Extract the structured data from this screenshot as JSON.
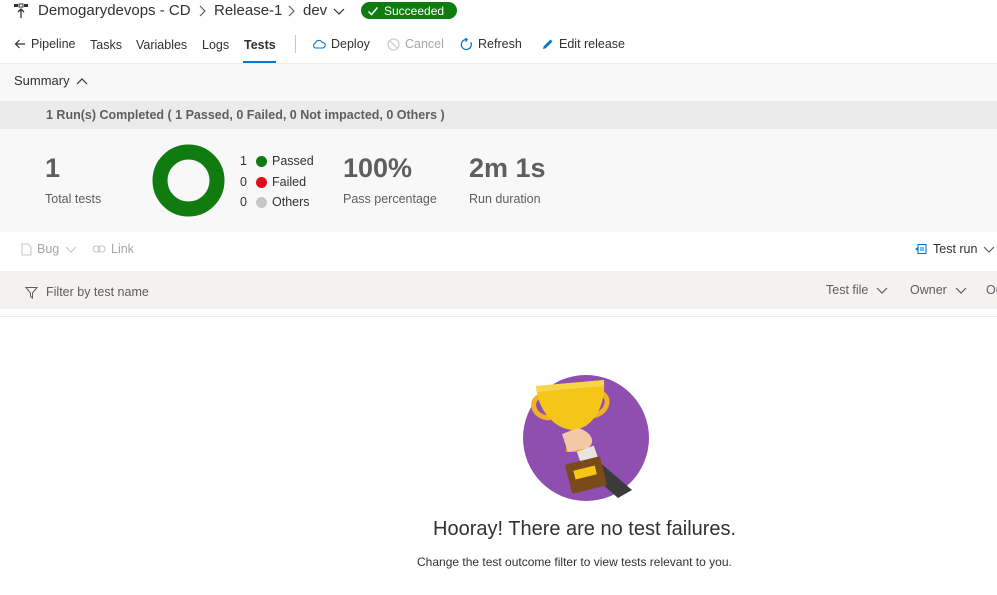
{
  "breadcrumb": {
    "pipeline": "Demogarydevops - CD",
    "release": "Release-1",
    "stage": "dev",
    "status": "Succeeded"
  },
  "toolbar": {
    "back_label": "Pipeline",
    "tabs": [
      "Tasks",
      "Variables",
      "Logs",
      "Tests"
    ],
    "active_tab": "Tests",
    "deploy": "Deploy",
    "cancel": "Cancel",
    "refresh": "Refresh",
    "edit_release": "Edit release"
  },
  "summary": {
    "title": "Summary",
    "runs_completed": "1 Run(s) Completed ( 1 Passed, 0 Failed, 0 Not impacted, 0 Others )",
    "total_tests": "1",
    "total_tests_label": "Total tests",
    "legend": [
      {
        "count": "1",
        "label": "Passed",
        "color": "#107c10"
      },
      {
        "count": "0",
        "label": "Failed",
        "color": "#e00b1c"
      },
      {
        "count": "0",
        "label": "Others",
        "color": "#c8c6c4"
      }
    ],
    "pass_percentage": "100%",
    "pass_percentage_label": "Pass percentage",
    "run_duration": "2m 1s",
    "run_duration_label": "Run duration"
  },
  "actions": {
    "bug": "Bug",
    "link": "Link",
    "test_run": "Test run"
  },
  "filters": {
    "placeholder": "Filter by test name",
    "test_file": "Test file",
    "owner": "Owner",
    "outcome_partial": "Ou"
  },
  "empty_state": {
    "title": "Hooray! There are no test failures.",
    "subtitle": "Change the test outcome filter to view tests relevant to you."
  },
  "colors": {
    "accent": "#0078d4",
    "success": "#107c10",
    "failed": "#e00b1c",
    "others": "#c8c6c4",
    "trophy_circle": "#8e4fb0"
  }
}
